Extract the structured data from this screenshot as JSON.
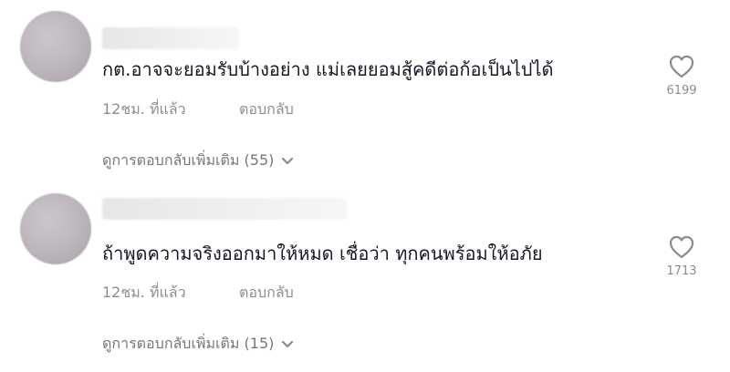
{
  "comments": [
    {
      "text": "กต.อาจจะยอมรับบ้างอย่าง แม่เลยยอมสู้คดีต่อก้อเป็นไปได้",
      "time": "12ชม. ที่แล้ว",
      "reply_label": "ตอบกลับ",
      "likes": "6199",
      "view_replies": "ดูการตอบกลับเพิ่มเติม (55)"
    },
    {
      "text": "ถ้าพูดความจริงออกมาให้หมด เชื่อว่า ทุกคนพร้อมให้อภัย",
      "time": "12ชม. ที่แล้ว",
      "reply_label": "ตอบกลับ",
      "likes": "1713",
      "view_replies": "ดูการตอบกลับเพิ่มเติม (15)"
    }
  ],
  "icons": {
    "like": "heart-outline-icon",
    "expand": "chevron-down-icon"
  },
  "colors": {
    "text": "#161823",
    "muted": "#8a8b91"
  }
}
